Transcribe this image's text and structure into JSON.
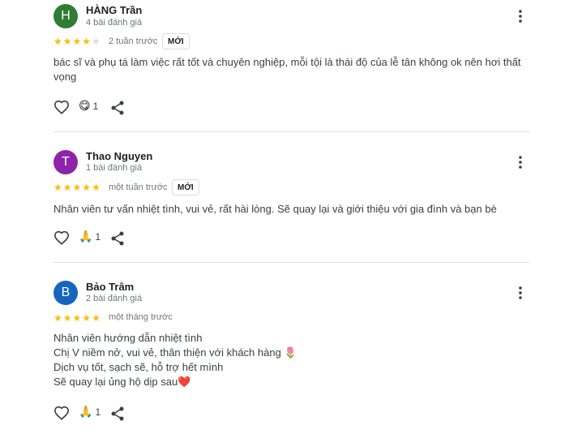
{
  "reviews": [
    {
      "avatar_letter": "H",
      "avatar_color": "#2e7d32",
      "name": "HÀNG Trần",
      "review_count": "4 bài đánh giá",
      "rating": 4,
      "time": "2 tuần trước",
      "badge": "MỚI",
      "text_lines": [
        "bác sĩ và phụ tá làm việc rất tốt và chuyên nghiệp, mỗi tội là thái độ của lễ tân không ok nên hơi thất vọng"
      ],
      "reaction_icon": "face-savoring-icon",
      "reaction_glyph": "😋",
      "reaction_count": "1"
    },
    {
      "avatar_letter": "T",
      "avatar_color": "#8e24aa",
      "name": "Thao Nguyen",
      "review_count": "1 bài đánh giá",
      "rating": 5,
      "time": "một tuần trước",
      "badge": "MỚI",
      "text_lines": [
        "Nhân viên tư vấn nhiệt tình, vui vẻ, rất hài lòng. Sẽ quay lại và giới thiệu với gia đình và bạn bè"
      ],
      "reaction_icon": "folded-hands-icon",
      "reaction_glyph": "🙏",
      "reaction_count": "1"
    },
    {
      "avatar_letter": "B",
      "avatar_color": "#1565c0",
      "name": "Bảo Trâm",
      "review_count": "2 bài đánh giá",
      "rating": 5,
      "time": "một tháng trước",
      "badge": "",
      "text_lines": [
        "Nhân viên hướng dẫn nhiệt tình",
        "Chị V niềm nở, vui vẻ, thân thiện với khách hàng 🌷",
        "Dịch vụ tốt, sạch sẽ, hỗ trợ hết mình",
        "Sẽ quay lại ủng hộ dịp sau❤️"
      ],
      "reaction_icon": "folded-hands-icon",
      "reaction_glyph": "🙏",
      "reaction_count": "1"
    }
  ],
  "colors": {
    "star": "#fbbc04",
    "star_empty": "#dadce0",
    "divider": "#e0e0e0"
  }
}
